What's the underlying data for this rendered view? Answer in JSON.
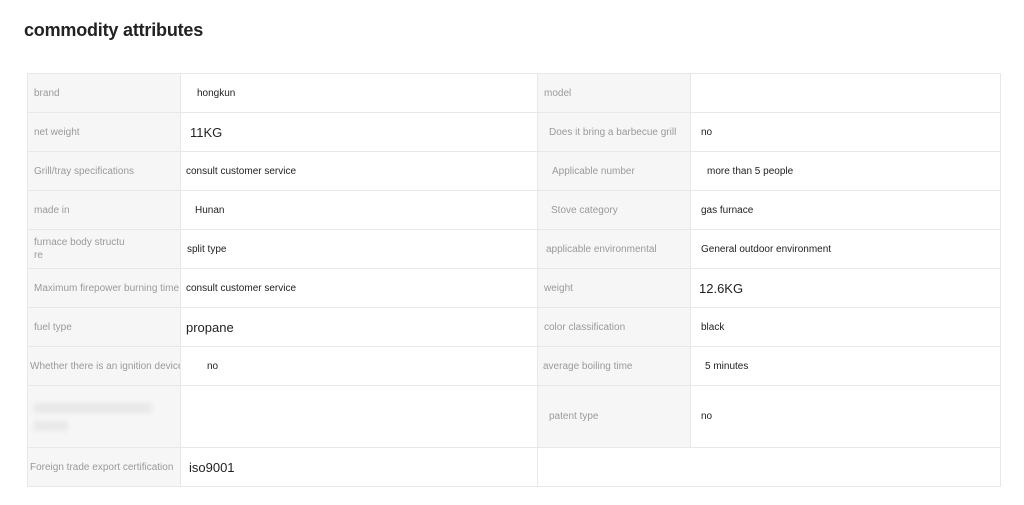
{
  "page_title": "commodity attributes",
  "rows": [
    {
      "label1": "brand",
      "value1": "hongkun",
      "label2": "model",
      "value2": ""
    },
    {
      "label1": "net weight",
      "value1": "11KG",
      "label2": "Does it bring a barbecue grill",
      "value2": "no"
    },
    {
      "label1": "Grill/tray specifications",
      "value1": "consult customer service",
      "label2": "Applicable number",
      "value2": "more than 5 people"
    },
    {
      "label1": "made in",
      "value1": "Hunan",
      "label2": "Stove category",
      "value2": "gas furnace"
    },
    {
      "label1": "furnace body structu re",
      "value1": "split type",
      "label2": "applicable environmental",
      "value2": "General outdoor environment"
    },
    {
      "label1": "Maximum firepower burning time",
      "value1": "consult customer service",
      "label2": "weight",
      "value2": "12.6KG"
    },
    {
      "label1": "fuel type",
      "value1": "propane",
      "label2": "color classification",
      "value2": "black"
    },
    {
      "label1": "Whether there is an ignition device",
      "value1": "no",
      "label2": "average boiling time",
      "value2": "5 minutes"
    },
    {
      "label1": "",
      "value1": "",
      "label2": "patent type",
      "value2": "no"
    },
    {
      "label1": "Foreign trade export certification",
      "value1": "iso9001",
      "label2": "",
      "value2": ""
    }
  ]
}
